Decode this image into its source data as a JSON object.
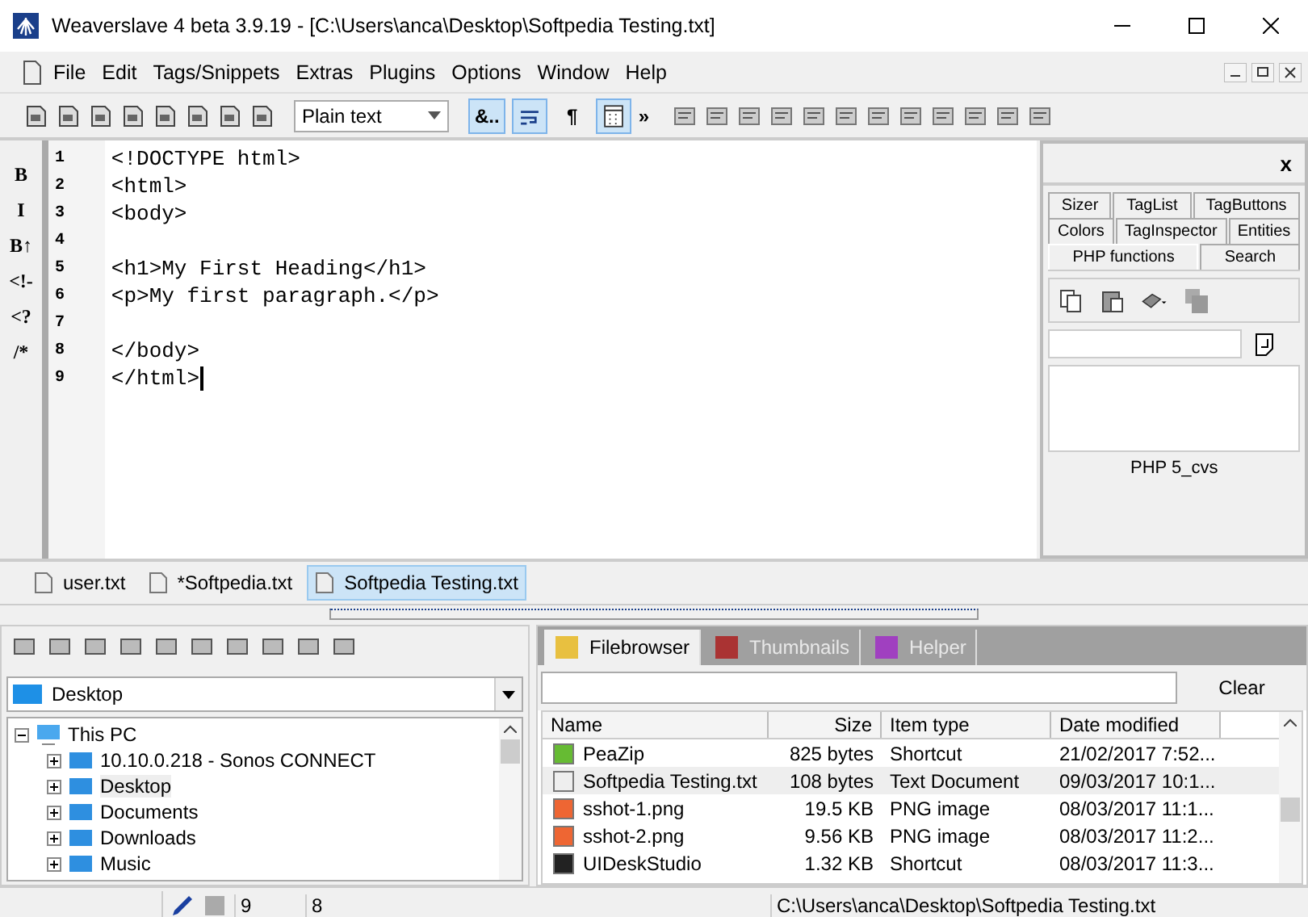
{
  "window": {
    "title": "Weaverslave 4 beta 3.9.19 - [C:\\Users\\anca\\Desktop\\Softpedia Testing.txt]"
  },
  "menu": [
    "File",
    "Edit",
    "Tags/Snippets",
    "Extras",
    "Plugins",
    "Options",
    "Window",
    "Help"
  ],
  "toolbar": {
    "language": "Plain text",
    "toggles": [
      {
        "kind": "text",
        "label": "&..",
        "selected": true
      },
      {
        "kind": "wrap",
        "selected": true
      },
      {
        "kind": "text",
        "label": "¶",
        "selected": false
      },
      {
        "kind": "grid",
        "selected": true
      }
    ],
    "more": "»"
  },
  "tag_bar": [
    "B",
    "I",
    "B↑",
    "<!-",
    "<?",
    "/*"
  ],
  "editor": {
    "lines": [
      {
        "number": "1",
        "code": "<!DOCTYPE html>"
      },
      {
        "number": "2",
        "code": "<html>"
      },
      {
        "number": "3",
        "code": "<body>"
      },
      {
        "number": "4"
      },
      {
        "number": "5",
        "code": "<h1>My First Heading</h1>"
      },
      {
        "number": "6",
        "code": "<p>My first paragraph.</p>"
      },
      {
        "number": "7"
      },
      {
        "number": "8",
        "code": "</body>"
      },
      {
        "number": "9",
        "code": "</html>"
      }
    ]
  },
  "side_panel": {
    "close": "x",
    "tab_rows": [
      [
        {
          "label": "Sizer",
          "selected": false
        },
        {
          "label": "TagList",
          "selected": false
        },
        {
          "label": "TagButtons",
          "selected": false
        }
      ],
      [
        {
          "label": "Colors",
          "selected": false
        },
        {
          "label": "TagInspector",
          "selected": false
        },
        {
          "label": "Entities",
          "selected": false
        }
      ],
      [
        {
          "label": "PHP functions",
          "selected": true
        },
        {
          "label": "Search",
          "selected": false
        }
      ]
    ],
    "caption": "PHP 5_cvs"
  },
  "document_tabs": [
    {
      "label": "user.txt",
      "selected": false
    },
    {
      "label": "*Softpedia.txt",
      "selected": false
    },
    {
      "label": "Softpedia Testing.txt",
      "selected": true
    }
  ],
  "folder_pane": {
    "location": "Desktop",
    "tree": [
      {
        "label": "This PC",
        "expanded": true,
        "selected": false,
        "children": [
          {
            "label": "10.10.0.218 - Sonos CONNECT",
            "expanded": false,
            "selected": false
          },
          {
            "label": "Desktop",
            "expanded": false,
            "selected": true
          },
          {
            "label": "Documents",
            "expanded": false,
            "selected": false
          },
          {
            "label": "Downloads",
            "expanded": false,
            "selected": false
          },
          {
            "label": "Music",
            "expanded": false,
            "selected": false
          }
        ]
      }
    ]
  },
  "file_pane": {
    "tabs": [
      {
        "label": "Filebrowser",
        "selected": true
      },
      {
        "label": "Thumbnails",
        "selected": false
      },
      {
        "label": "Helper",
        "selected": false
      }
    ],
    "clear_button": "Clear",
    "columns": [
      "Name",
      "Size",
      "Item type",
      "Date modified"
    ],
    "rows": [
      {
        "name": "PeaZip",
        "size": "825 bytes",
        "type": "Shortcut",
        "date": "21/02/2017 7:52...",
        "selected": false
      },
      {
        "name": "Softpedia Testing.txt",
        "size": "108 bytes",
        "type": "Text Document",
        "date": "09/03/2017 10:1...",
        "selected": true
      },
      {
        "name": "sshot-1.png",
        "size": "19.5 KB",
        "type": "PNG image",
        "date": "08/03/2017 11:1...",
        "selected": false
      },
      {
        "name": "sshot-2.png",
        "size": "9.56 KB",
        "type": "PNG image",
        "date": "08/03/2017 11:2...",
        "selected": false
      },
      {
        "name": "UIDeskStudio",
        "size": "1.32 KB",
        "type": "Shortcut",
        "date": "08/03/2017 11:3...",
        "selected": false
      }
    ]
  },
  "status_bar": {
    "line": "9",
    "column": "8",
    "path": "C:\\Users\\anca\\Desktop\\Softpedia Testing.txt"
  }
}
